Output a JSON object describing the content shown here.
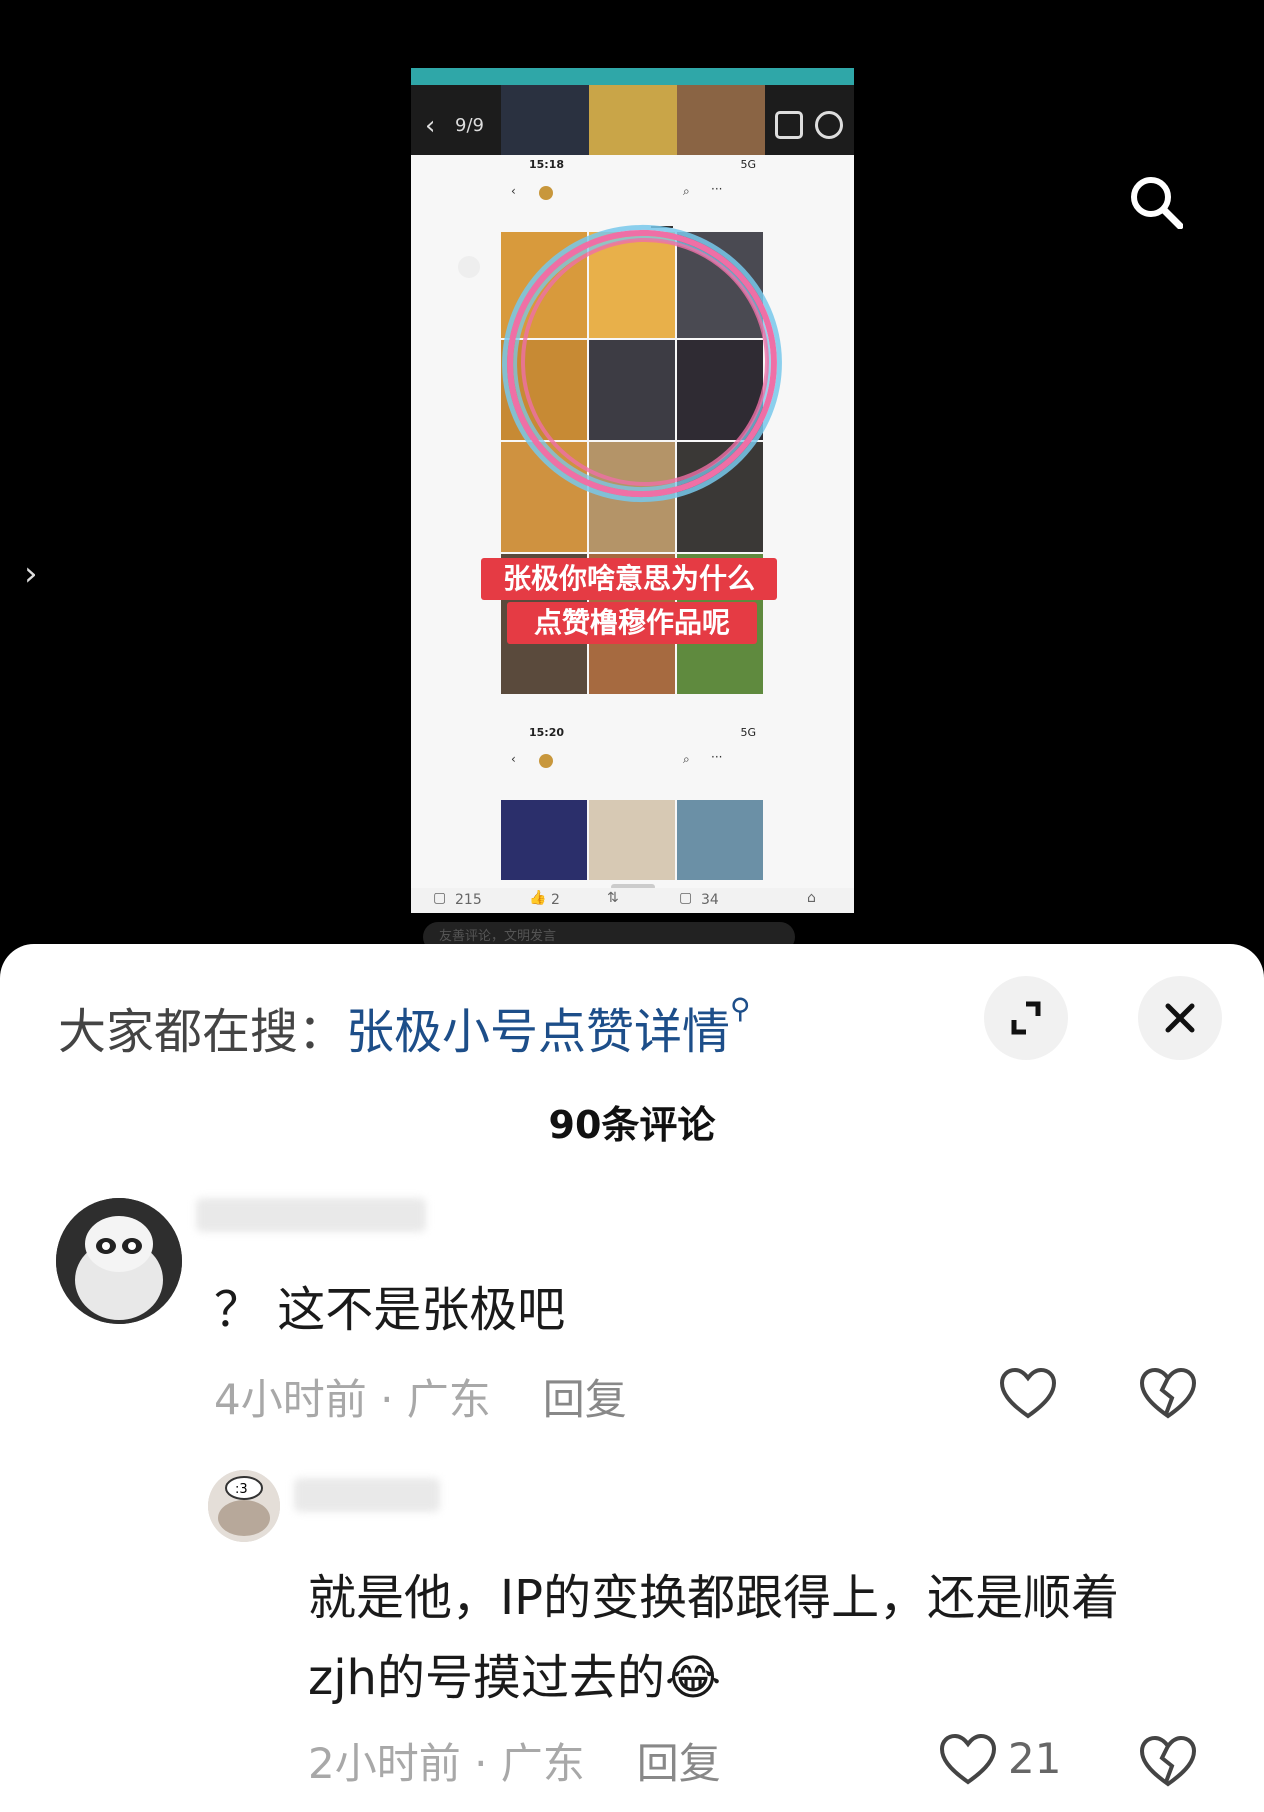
{
  "viewer": {
    "pager": "9/9",
    "time1": "15:18",
    "time2": "15:20",
    "signal": "5G",
    "caption_line1": "张极你啥意思为什么",
    "caption_line2": "点赞橹穆作品呢",
    "bottom_comments": "215",
    "bottom_likes": "2",
    "bottom_shares": "34",
    "input_placeholder": "友善评论，文明发言"
  },
  "sheet": {
    "hot_search_prefix": "大家都在搜：",
    "hot_search_link": "张极小号点赞详情",
    "comment_count": "90条评论"
  },
  "comments": [
    {
      "text": "？ 这不是张极吧",
      "time": "4小时前 · 广东",
      "reply_label": "回复"
    },
    {
      "text_line1": "就是他，IP的变换都跟得上，还是顺着",
      "text_line2": "zjh的号摸过去的😂",
      "time": "2小时前 · 广东",
      "reply_label": "回复",
      "likes": "21"
    }
  ],
  "icons": {
    "search": "search-icon",
    "expand": "expand-icon",
    "close": "close-icon",
    "like": "heart-icon",
    "dislike": "broken-heart-icon"
  }
}
